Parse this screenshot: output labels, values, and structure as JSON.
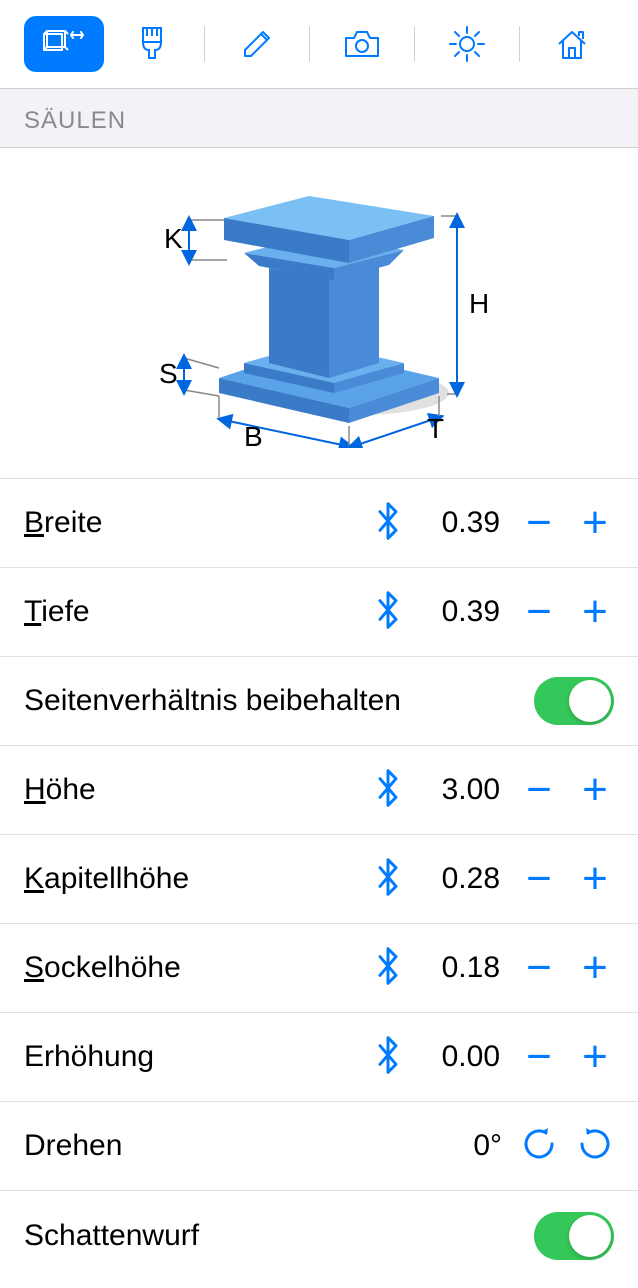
{
  "section_title": "SÄULEN",
  "diagram_labels": {
    "K": "K",
    "S": "S",
    "B": "B",
    "H": "H",
    "T": "T"
  },
  "rows": {
    "breite": {
      "label_prefix": "B",
      "label_rest": "reite",
      "value": "0.39"
    },
    "tiefe": {
      "label_prefix": "T",
      "label_rest": "iefe",
      "value": "0.39"
    },
    "aspect": {
      "label": "Seitenverhältnis beibehalten",
      "on": true
    },
    "hoehe": {
      "label_prefix": "H",
      "label_rest": "öhe",
      "value": "3.00"
    },
    "kapitell": {
      "label_prefix": "K",
      "label_rest": "apitellhöhe",
      "value": "0.28"
    },
    "sockel": {
      "label_prefix": "S",
      "label_rest": "ockelhöhe",
      "value": "0.18"
    },
    "erhoehung": {
      "label": "Erhöhung",
      "value": "0.00"
    },
    "drehen": {
      "label": "Drehen",
      "value": "0°"
    },
    "schatten": {
      "label": "Schattenwurf",
      "on": true
    }
  }
}
